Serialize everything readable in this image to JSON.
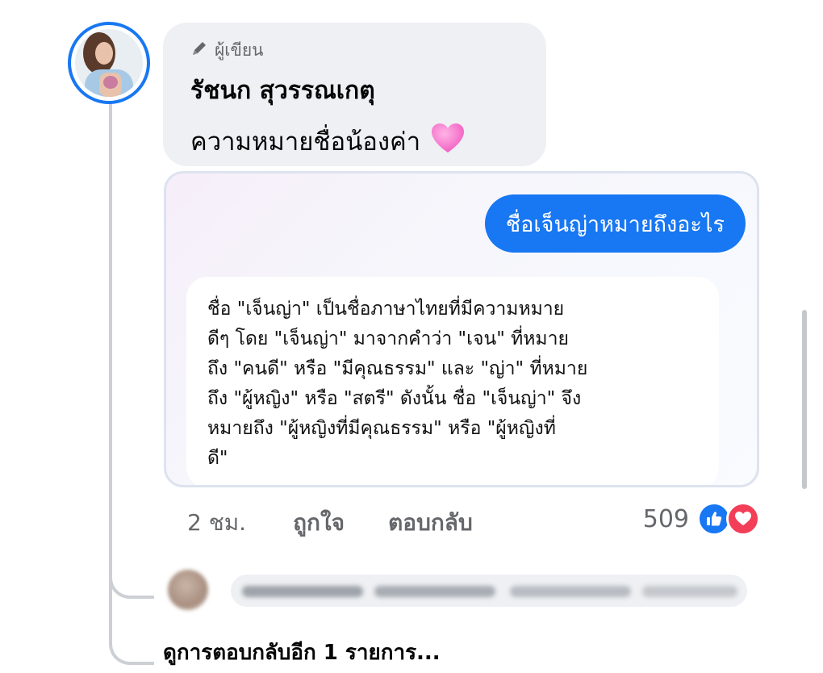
{
  "comment": {
    "author_badge": "ผู้เขียน",
    "author_name": "รัชนก สุวรรณเกตุ",
    "text": "ความหมายชื่อน้องค่า",
    "emoji": "pink-heart",
    "time": "2 ชม.",
    "like_label": "ถูกใจ",
    "reply_label": "ตอบกลับ",
    "reaction_count": "509",
    "reactions": [
      "like-icon",
      "love-icon"
    ]
  },
  "chat_image": {
    "question": "ชื่อเจ็นญ่าหมายถึงอะไร",
    "answer_lines": [
      "ชื่อ \"เจ็นญ่า\" เป็นชื่อภาษาไทยที่มีความหมาย",
      "ดีๆ โดย \"เจ็นญ่า\" มาจากคำว่า \"เจน\" ที่หมาย",
      "ถึง \"คนดี\" หรือ \"มีคุณธรรม\" และ \"ญ่า\" ที่หมาย",
      "ถึง \"ผู้หญิง\" หรือ \"สตรี\" ดังนั้น ชื่อ \"เจ็นญ่า\" จึง",
      "หมายถึง \"ผู้หญิงที่มีคุณธรรม\" หรือ \"ผู้หญิงที่",
      "ดี\""
    ]
  },
  "more_replies": "ดูการตอบกลับอีก 1 รายการ...",
  "colors": {
    "accent": "#1877f2",
    "bubble": "#eef0f3",
    "love": "#f33e58",
    "muted_text": "#65676b"
  }
}
